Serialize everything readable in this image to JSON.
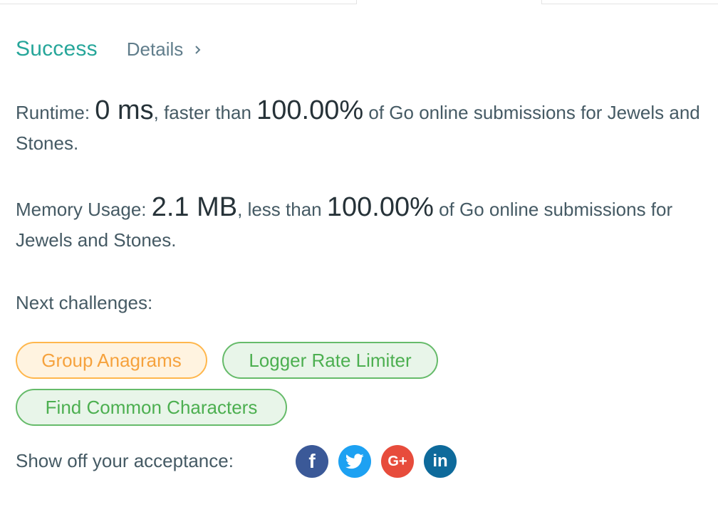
{
  "result": {
    "status": "Success",
    "details_label": "Details"
  },
  "runtime": {
    "label": "Runtime: ",
    "value": "0 ms",
    "comparison": ", faster than ",
    "percent": "100.00%",
    "suffix": " of Go online submissions for Jewels and Stones."
  },
  "memory": {
    "label": "Memory Usage: ",
    "value": "2.1 MB",
    "comparison": ", less than ",
    "percent": "100.00%",
    "suffix": " of Go online submissions for Jewels and Stones."
  },
  "next_challenges": {
    "label": "Next challenges:",
    "items": [
      {
        "title": "Group Anagrams",
        "difficulty_color": "#f6a23d"
      },
      {
        "title": "Logger Rate Limiter",
        "difficulty_color": "#4caf50"
      },
      {
        "title": "Find Common Characters",
        "difficulty_color": "#4caf50"
      }
    ]
  },
  "share": {
    "label": "Show off your acceptance:",
    "networks": [
      {
        "name": "facebook-icon",
        "glyph": "f",
        "color": "#3b5998"
      },
      {
        "name": "twitter-icon",
        "glyph": "",
        "color": "#1da1f2"
      },
      {
        "name": "google-plus-icon",
        "glyph": "G+",
        "color": "#e74c3c"
      },
      {
        "name": "linkedin-icon",
        "glyph": "in",
        "color": "#0e6a9b"
      }
    ]
  },
  "colors": {
    "success": "#26a69a",
    "text": "#455a64"
  }
}
